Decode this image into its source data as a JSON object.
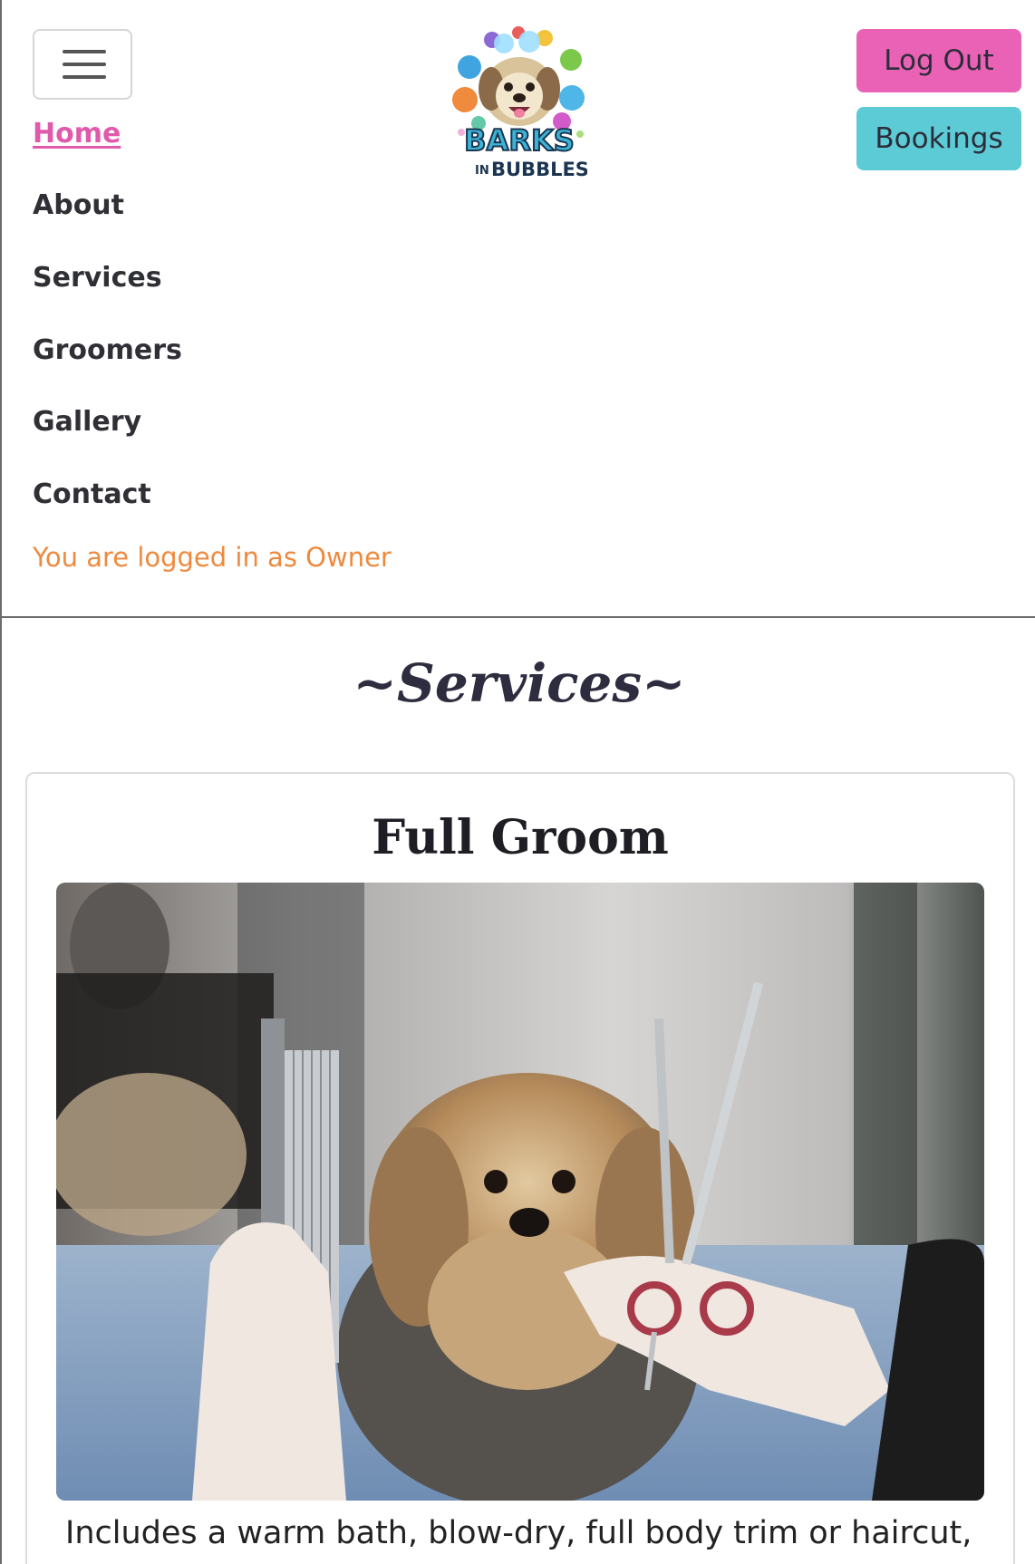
{
  "header": {
    "logo_line1": "BARKS",
    "logo_line2": "BUBBLES",
    "logo_small": "IN",
    "logout_label": "Log Out",
    "bookings_label": "Bookings"
  },
  "nav": {
    "items": [
      {
        "label": "Home",
        "active": true
      },
      {
        "label": "About"
      },
      {
        "label": "Services"
      },
      {
        "label": "Groomers"
      },
      {
        "label": "Gallery"
      },
      {
        "label": "Contact"
      }
    ],
    "logged_in_text": "You are logged in as Owner"
  },
  "main": {
    "section_title": "~Services~",
    "card": {
      "title": "Full Groom",
      "description": "Includes a warm bath, blow-dry, full body trim or haircut,"
    }
  },
  "colors": {
    "logout": "#ea62b5",
    "bookings": "#5ccbd6",
    "active_link": "#e05aab",
    "logged_in": "#ee8a3f"
  },
  "icons": {
    "menu": "hamburger-menu-icon"
  }
}
